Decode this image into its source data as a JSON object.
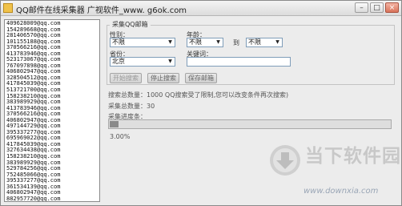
{
  "window": {
    "title": "QQ邮件在线采集器 广视软件_www. g6ok.com",
    "minimize_glyph": "–",
    "maximize_glyph": "□",
    "close_glyph": "×"
  },
  "email_list": [
    "409628009@qq.com",
    "154289668@qq.com",
    "281406570@qq.com",
    "101155188@qq.com",
    "370566216@qq.com",
    "413783946@qq.com",
    "523173067@qq.com",
    "767097898@qq.com",
    "406802947@qq.com",
    "328504512@qq.com",
    "417845039@qq.com",
    "513721700@qq.com",
    "158238210@qq.com",
    "383989929@qq.com",
    "413783946@qq.com",
    "370566216@qq.com",
    "406802947@qq.com",
    "497144729@qq.com",
    "395337277@qq.com",
    "695969022@qq.com",
    "417845039@qq.com",
    "327634438@qq.com",
    "158238210@qq.com",
    "383989929@qq.com",
    "529784256@qq.com",
    "752485066@qq.com",
    "395337277@qq.com",
    "361534139@qq.com",
    "406802947@qq.com",
    "882957720@qq.com"
  ],
  "filter": {
    "legend": "采集QQ邮箱",
    "gender_label": "性别：",
    "gender_value": "不限",
    "age_label": "年龄：",
    "age_from": "不限",
    "age_to_label": "到",
    "age_to": "不限",
    "province_label": "省份：",
    "province_value": "北京",
    "keyword_label": "关键词：",
    "keyword_value": ""
  },
  "buttons": {
    "start": "开始搜索",
    "stop": "停止搜索",
    "save": "保存邮箱"
  },
  "status": {
    "search_total": "搜索总数量：1000 QQ搜索受了限制,您可以改变条件再次搜索)",
    "collect_total": "采集总数量：30",
    "progress_label": "采集进度条：",
    "progress_value": 0.03,
    "progress_text": "3.00%"
  },
  "watermark": {
    "text": "当下软件园",
    "url": "www.downxia.com"
  },
  "colors": {
    "progress_fill": "#8a8a8a",
    "watermark_green": "#c9d6c9"
  }
}
